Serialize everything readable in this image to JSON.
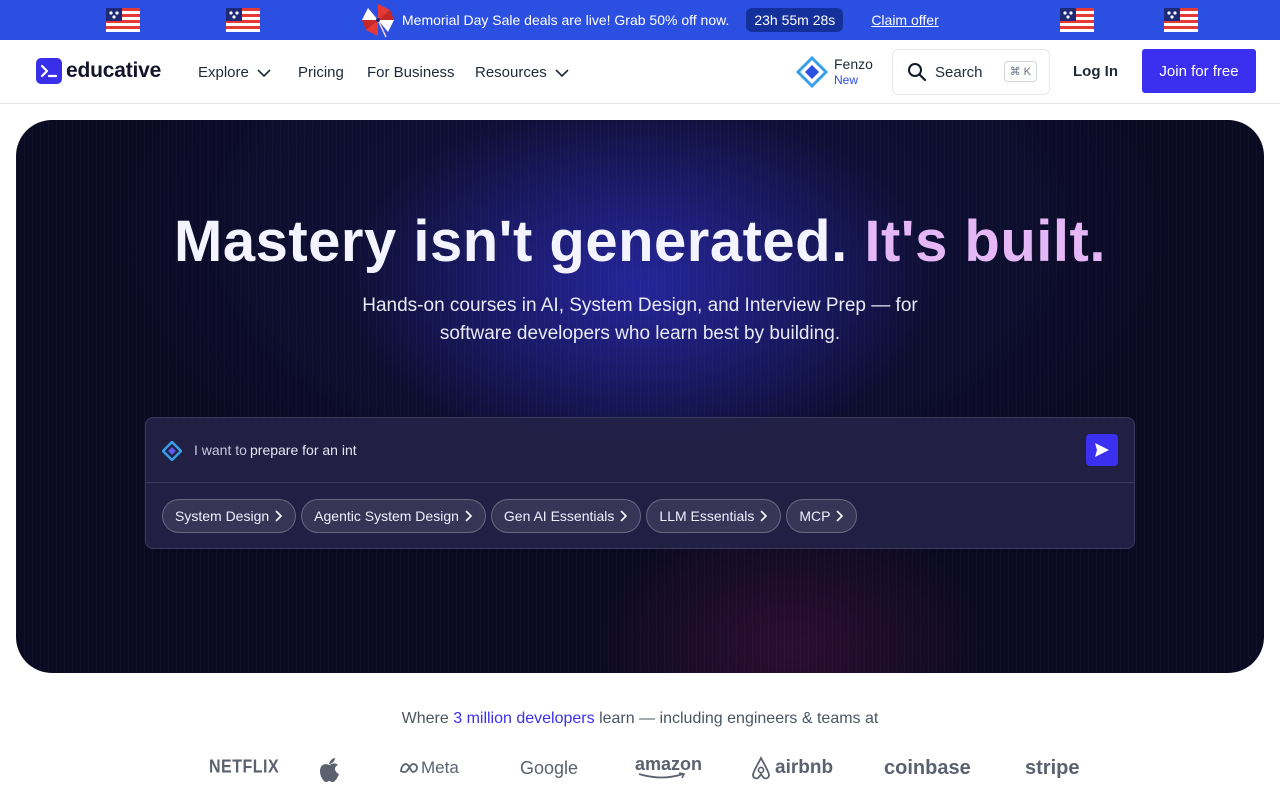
{
  "promo": {
    "text": "Memorial Day Sale deals are live! Grab 50% off now.",
    "timer": "23h 55m 28s",
    "cta": "Claim offer"
  },
  "nav": {
    "logo": "educative",
    "items": [
      {
        "label": "Explore"
      },
      {
        "label": "Pricing"
      },
      {
        "label": "For Business"
      },
      {
        "label": "Resources"
      }
    ],
    "fenzo_name": "Fenzo",
    "fenzo_badge": "New",
    "search_label": "Search",
    "search_shortcut": "⌘ K",
    "login": "Log In",
    "join": "Join for free"
  },
  "hero": {
    "headline_main": "Mastery isn't generated.",
    "headline_accent": "It's built.",
    "subhead": "Hands-on courses in AI, System Design, and Interview Prep — for software developers who learn best by building.",
    "prompt_prefix": "I want to",
    "prompt_value": "prepare for an int",
    "chips": [
      {
        "label": "System Design"
      },
      {
        "label": "Agentic System Design"
      },
      {
        "label": "Gen AI Essentials"
      },
      {
        "label": "LLM Essentials"
      },
      {
        "label": "MCP"
      }
    ]
  },
  "proof": {
    "prefix": "Where",
    "highlight": "3 million developers",
    "suffix": "learn — including engineers & teams at",
    "brands": [
      "NETFLIX",
      "Meta",
      "Google",
      "amazon",
      "airbnb",
      "coinbase",
      "stripe"
    ]
  },
  "colors": {
    "banner": "#2b4fe0",
    "primary": "#3b2ff0",
    "accent_pink": "#e6b7f6",
    "hero_bg": "#0a0a22"
  }
}
